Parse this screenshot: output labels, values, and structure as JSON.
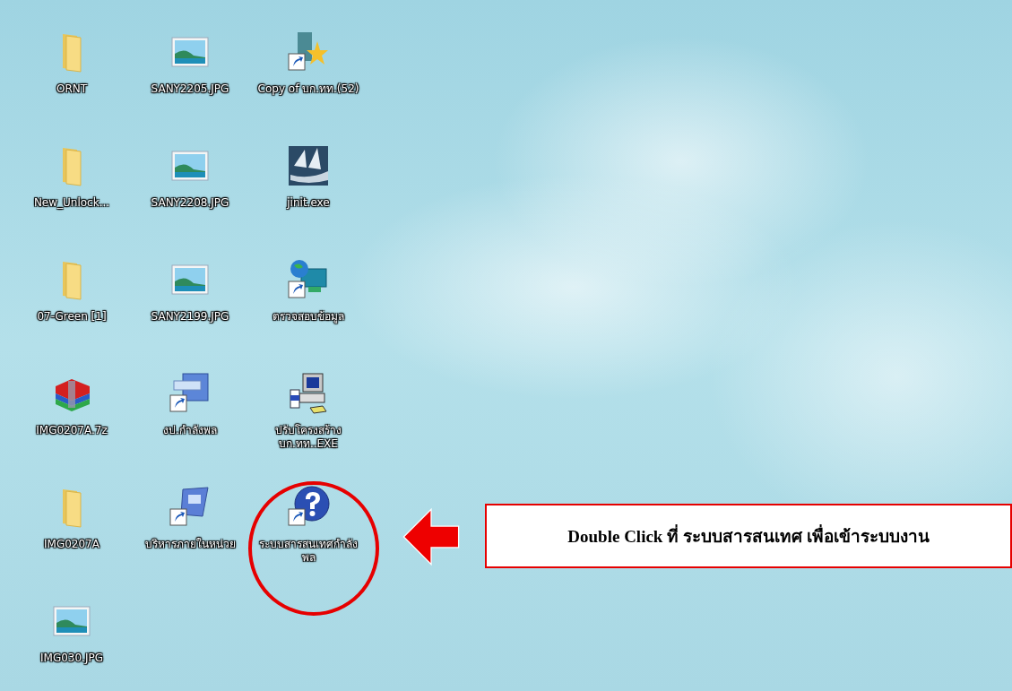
{
  "desktop": {
    "icons": [
      {
        "label": "ORNT",
        "kind": "folder"
      },
      {
        "label": "SANY2205.JPG",
        "kind": "image"
      },
      {
        "label": "Copy of บก.ทท.(52)",
        "kind": "star-shortcut"
      },
      {
        "label": "New_Unlock...",
        "kind": "folder"
      },
      {
        "label": "SANY2208.JPG",
        "kind": "image"
      },
      {
        "label": "jinit.exe",
        "kind": "sail"
      },
      {
        "label": "07-Green [1]",
        "kind": "folder"
      },
      {
        "label": "SANY2199.JPG",
        "kind": "image"
      },
      {
        "label": "ตรวจสอบข้อมูล",
        "kind": "globe-shortcut"
      },
      {
        "label": "IMG0207A.7z",
        "kind": "archive"
      },
      {
        "label": "งป.กำลังพล",
        "kind": "keyboard-shortcut"
      },
      {
        "label": "ปรับโครงสร้าง บก.ทท..EXE",
        "kind": "installer"
      },
      {
        "label": "IMG0207A",
        "kind": "folder"
      },
      {
        "label": "บริหารภายในหน่วย",
        "kind": "app-shortcut"
      },
      {
        "label": "ระบบสารสนเทศกำลังพล",
        "kind": "help-shortcut"
      },
      {
        "label": "IMG030.JPG",
        "kind": "image"
      }
    ]
  },
  "annotation": {
    "callout_text": "Double Click ที่ ระบบสารสนเทศ  เพื่อเข้าระบบงาน"
  }
}
